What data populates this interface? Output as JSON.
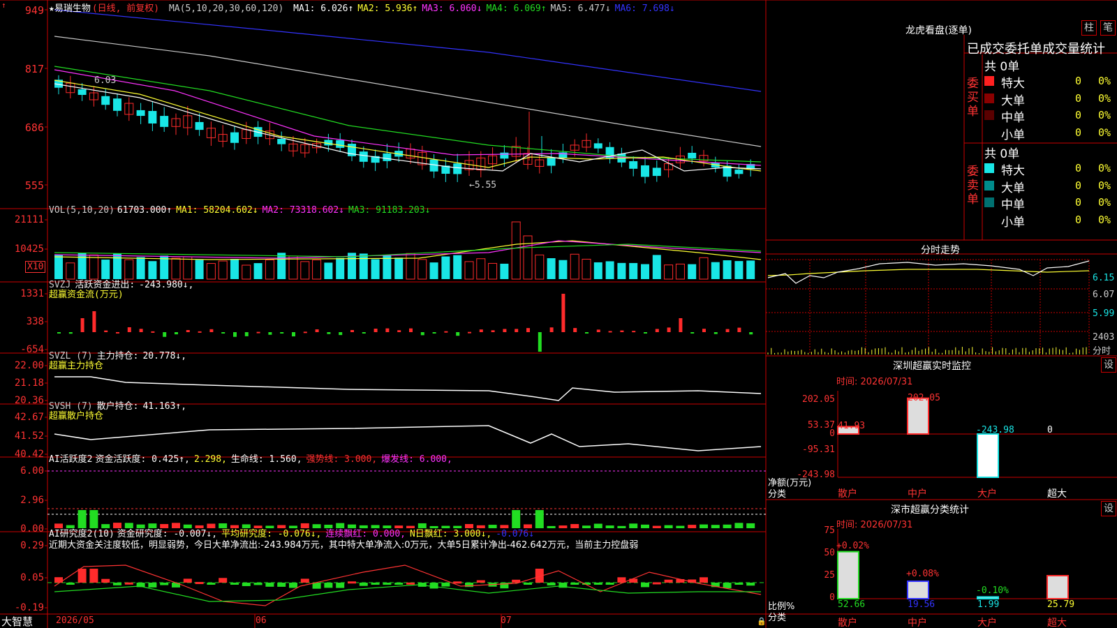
{
  "colors": {
    "up": "#ff2b2b",
    "down": "#19e6e6",
    "green": "#22dd22",
    "yellow": "#ffff33",
    "magenta": "#ff33ff",
    "blue": "#3333ff",
    "white": "#ffffff",
    "grid": "#cc0000",
    "red_text": "#ff3333"
  },
  "bottom_bar": {
    "app_name": "大智慧",
    "dates": [
      "2026/05",
      "06",
      "07"
    ]
  },
  "main_chart": {
    "header_icon": "star-icon",
    "stock_name": "★易瑞生物",
    "period": "(日线, 前复权)",
    "ma_label": "MA(5,10,20,30,60,120)",
    "ma_values": [
      {
        "label": "MA1:",
        "value": "6.026↑",
        "color": "#ffffff"
      },
      {
        "label": "MA2:",
        "value": "5.936↑",
        "color": "#ffff33"
      },
      {
        "label": "MA3:",
        "value": "6.060↓",
        "color": "#ff33ff"
      },
      {
        "label": "MA4:",
        "value": "6.069↑",
        "color": "#22dd22"
      },
      {
        "label": "MA5:",
        "value": "6.477↓",
        "color": "#cccccc"
      },
      {
        "label": "MA6:",
        "value": "7.698↓",
        "color": "#3333ff"
      }
    ],
    "y_ticks": [
      "949",
      "817",
      "686",
      "555"
    ],
    "hi_label": "6.03",
    "lo_label": "←5.55"
  },
  "chart_data": [
    {
      "type": "candlestick",
      "title": "易瑞生物 日线 前复权",
      "y_ticks": [
        949,
        817,
        686,
        555
      ],
      "series": [
        {
          "name": "MA1",
          "value": 6.026
        },
        {
          "name": "MA2",
          "value": 5.936
        },
        {
          "name": "MA3",
          "value": 6.06
        },
        {
          "name": "MA4",
          "value": 6.069
        },
        {
          "name": "MA5",
          "value": 6.477
        },
        {
          "name": "MA6",
          "value": 7.698
        }
      ],
      "annotations": [
        "6.03",
        "←5.55"
      ]
    },
    {
      "type": "bar",
      "title": "VOL(5,10,20)",
      "value": 61703.0,
      "series": [
        {
          "name": "MA1",
          "value": 58204.602
        },
        {
          "name": "MA2",
          "value": 73318.602
        },
        {
          "name": "MA3",
          "value": 91183.203
        }
      ],
      "y_ticks": [
        21111,
        10425
      ],
      "unit": "X10"
    },
    {
      "type": "bar",
      "title": "SVZJ 活跃资金进出",
      "value": -243.98,
      "y_ticks": [
        1331,
        338,
        -654
      ]
    },
    {
      "type": "line",
      "title": "SVZL (7) 主力持仓",
      "value": 20.778,
      "y_ticks": [
        22.0,
        21.18,
        20.36
      ]
    },
    {
      "type": "line",
      "title": "SVSH (7) 散户持仓",
      "value": 41.163,
      "y_ticks": [
        42.67,
        41.52,
        40.42
      ]
    },
    {
      "type": "bar",
      "title": "AI活跃度2 资金活跃度",
      "values": {
        "资金活跃度": 0.425,
        "2": 2.298,
        "生命线": 1.56,
        "强势线": 3.0,
        "爆发线": 6.0
      },
      "y_ticks": [
        6.0,
        2.96,
        0.0
      ]
    },
    {
      "type": "bar",
      "title": "AI研究度2(10) 资金研究度",
      "values": {
        "资金研究度": -0.007,
        "平均研究度": -0.076,
        "连续飘红": 0.0,
        "N日飘红": 3.0,
        "4": -0.076
      },
      "y_ticks": [
        0.29,
        0.05,
        -0.19
      ]
    },
    {
      "type": "bar",
      "title": "深圳超赢实时监控",
      "categories": [
        "散户",
        "中户",
        "大户",
        "超大"
      ],
      "values": [
        41.93,
        202.05,
        -243.98,
        0
      ],
      "y_ticks": [
        202.05,
        53.37,
        0,
        -95.31,
        -243.98
      ]
    },
    {
      "type": "bar",
      "title": "深市超赢分类统计",
      "categories": [
        "散户",
        "中户",
        "大户",
        "超大"
      ],
      "values": [
        52.66,
        19.56,
        1.99,
        25.79
      ],
      "changes": [
        "+0.02%",
        "+0.08%",
        "-0.10%",
        ""
      ],
      "y_ticks": [
        75,
        50,
        25,
        0
      ]
    }
  ],
  "vol_panel": {
    "title": "VOL(5,10,20)",
    "value": "61703.000↑",
    "ma": [
      {
        "label": "MA1:",
        "value": "58204.602↓",
        "color": "#ffff33"
      },
      {
        "label": "MA2:",
        "value": "73318.602↓",
        "color": "#ff33ff"
      },
      {
        "label": "MA3:",
        "value": "91183.203↓",
        "color": "#22dd22"
      }
    ],
    "y_ticks": [
      "21111",
      "10425"
    ],
    "unit": "X10"
  },
  "svzj_panel": {
    "title": "SVZJ",
    "name": "活跃资金进出:",
    "value": "-243.980↓,",
    "subtitle": "超赢资金流(万元)",
    "y_ticks": [
      "1331",
      "338",
      "-654"
    ]
  },
  "svzl_panel": {
    "title": "SVZL (7)",
    "name": "主力持仓:",
    "value": "20.778↓,",
    "subtitle": "超赢主力持仓",
    "y_ticks": [
      "22.00",
      "21.18",
      "20.36"
    ]
  },
  "svsh_panel": {
    "title": "SVSH (7)",
    "name": "散户持仓:",
    "value": "41.163↑,",
    "subtitle": "超赢散户持仓",
    "y_ticks": [
      "42.67",
      "41.52",
      "40.42"
    ]
  },
  "ai_act_panel": {
    "title": "AI活跃度2",
    "items": [
      {
        "text": "资金活跃度: 0.425↑,",
        "color": "#ffffff"
      },
      {
        "text": "2.298,",
        "color": "#ffff33"
      },
      {
        "text": "生命线: 1.560,",
        "color": "#ffffff"
      },
      {
        "text": "强势线: 3.000,",
        "color": "#ff3333"
      },
      {
        "text": "爆发线: 6.000,",
        "color": "#ff33ff"
      }
    ],
    "y_ticks": [
      "6.00",
      "2.96",
      "0.00"
    ]
  },
  "ai_res_panel": {
    "title": "AI研究度2(10)",
    "items": [
      {
        "text": "资金研究度: -0.007↓,",
        "color": "#ffffff"
      },
      {
        "text": "平均研究度: -0.076↓,",
        "color": "#ffff33"
      },
      {
        "text": "连续飘红: 0.000,",
        "color": "#ff33ff"
      },
      {
        "text": "N日飘红: 3.000↓,",
        "color": "#ffff33"
      },
      {
        "text": "-0.076↓",
        "color": "#3333ff"
      }
    ],
    "comment": "近期大资金关注度较低，明显弱势，今日大单净流出:-243.984万元，其中特大单净流入:0万元，大单5日累计净出-462.642万元，当前主力控盘弱",
    "y_ticks": [
      "0.29",
      "0.05",
      "-0.19"
    ]
  },
  "right": {
    "lhb_title": "龙虎看盘(逐单)",
    "btn_zhu": "柱",
    "btn_bi": "笔",
    "order_title": "已成交委托单成交量统计",
    "buy_label": "委买单",
    "sell_label": "委卖单",
    "buy_total": "共 0单",
    "sell_total": "共 0单",
    "buy_rows": [
      {
        "name": "特大",
        "count": "0",
        "pct": "0%",
        "color": "#ff2020"
      },
      {
        "name": "大单",
        "count": "0",
        "pct": "0%",
        "color": "#8b0000"
      },
      {
        "name": "中单",
        "count": "0",
        "pct": "0%",
        "color": "#5a0000"
      },
      {
        "name": "小单",
        "count": "0",
        "pct": "0%",
        "color": ""
      }
    ],
    "sell_rows": [
      {
        "name": "特大",
        "count": "0",
        "pct": "0%",
        "color": "#19e6e6"
      },
      {
        "name": "大单",
        "count": "0",
        "pct": "0%",
        "color": "#008b8b"
      },
      {
        "name": "中单",
        "count": "0",
        "pct": "0%",
        "color": "#007070"
      },
      {
        "name": "小单",
        "count": "0",
        "pct": "0%",
        "color": ""
      }
    ],
    "intraday_title": "分时走势",
    "intraday_ticks": [
      "6.15",
      "6.07",
      "5.99"
    ],
    "intraday_vol": "2403",
    "intraday_vol_label": "分时",
    "sz_monitor_title": "深圳超赢实时监控",
    "sz_time": "时间: 2026/07/31",
    "sz_ticks": [
      "202.05",
      "53.37",
      "0",
      "-95.31",
      "-243.98"
    ],
    "sz_vals": [
      "41.93",
      "202.05",
      "-243.98",
      "0"
    ],
    "sz_ylabel1": "净额(万元)",
    "sz_ylabel2": "分类",
    "sz_cats": [
      "散户",
      "中户",
      "大户",
      "超大"
    ],
    "set_label": "设",
    "sh_stat_title": "深市超赢分类统计",
    "sh_time": "时间: 2026/07/31",
    "sh_ticks": [
      "75",
      "50",
      "25",
      "0"
    ],
    "sh_pcts": [
      "+0.02%",
      "+0.08%",
      "-0.10%"
    ],
    "sh_vals": [
      "52.66",
      "19.56",
      "1.99",
      "25.79"
    ],
    "sh_ylabel1": "比例%",
    "sh_ylabel2": "分类",
    "sh_cats": [
      "散户",
      "中户",
      "大户",
      "超大"
    ]
  }
}
